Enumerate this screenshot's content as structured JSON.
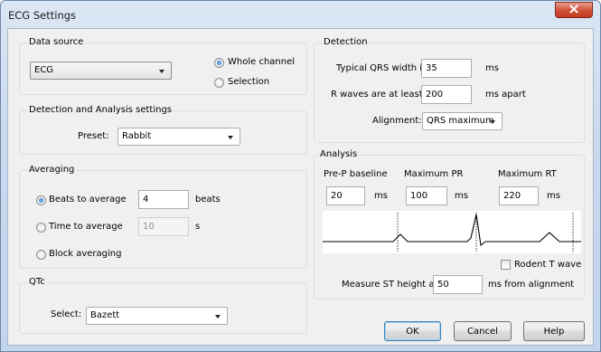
{
  "window": {
    "title": "ECG Settings",
    "close_icon": "close-icon"
  },
  "data_source": {
    "group_label": "Data source",
    "selected": "ECG",
    "radio_whole_channel": "Whole channel",
    "radio_selection": "Selection",
    "checked": "Whole channel"
  },
  "detection_analysis": {
    "group_label": "Detection and Analysis settings",
    "preset_label": "Preset:",
    "preset_value": "Rabbit"
  },
  "averaging": {
    "group_label": "Averaging",
    "beats_label": "Beats to average",
    "beats_value": "4",
    "beats_unit": "beats",
    "time_label": "Time to average",
    "time_value": "10",
    "time_unit": "s",
    "block_label": "Block averaging",
    "checked": "Beats to average"
  },
  "qtc": {
    "group_label": "QTc",
    "select_label": "Select:",
    "select_value": "Bazett"
  },
  "detection": {
    "group_label": "Detection",
    "qrs_label": "Typical QRS width is",
    "qrs_value": "35",
    "qrs_unit": "ms",
    "rwave_label": "R waves are at least",
    "rwave_value": "200",
    "rwave_unit": "ms apart",
    "alignment_label": "Alignment:",
    "alignment_value": "QRS maximum"
  },
  "analysis": {
    "group_label": "Analysis",
    "prep_label": "Pre-P baseline",
    "prep_value": "20",
    "prep_unit": "ms",
    "maxpr_label": "Maximum PR",
    "maxpr_value": "100",
    "maxpr_unit": "ms",
    "maxrt_label": "Maximum RT",
    "maxrt_value": "220",
    "maxrt_unit": "ms",
    "rodent_label": "Rodent T wave",
    "rodent_checked": false,
    "st_label": "Measure ST height at",
    "st_value": "50",
    "st_unit": "ms from alignment"
  },
  "buttons": {
    "ok": "OK",
    "cancel": "Cancel",
    "help": "Help"
  }
}
